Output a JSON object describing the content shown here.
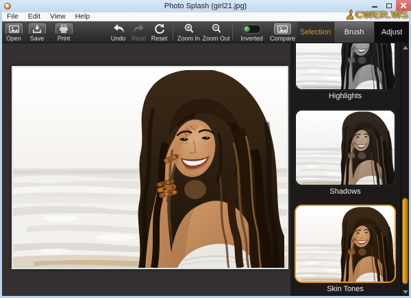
{
  "window": {
    "title": "Photo Splash (girl21.jpg)",
    "watermark": "CWER.WS"
  },
  "menu": {
    "items": [
      "File",
      "Edit",
      "View",
      "Help"
    ]
  },
  "toolbar": {
    "buttons": {
      "open": "Open",
      "save": "Save",
      "print": "Print",
      "undo": "Undo",
      "redo": "Redo",
      "reset": "Reset",
      "zoom_in": "Zoom In",
      "zoom_out": "Zoom Out",
      "inverted": "Inverted",
      "compare": "Compare"
    },
    "states": {
      "redo_enabled": false,
      "inverted_on": true
    }
  },
  "tabs": {
    "items": [
      {
        "label": "Selection",
        "active": true
      },
      {
        "label": "Brush",
        "active": false
      },
      {
        "label": "Adjust",
        "active": false
      }
    ]
  },
  "panel": {
    "thumbnails": [
      {
        "label": "Highlights",
        "selected": false,
        "filter": "grayscale"
      },
      {
        "label": "Shadows",
        "selected": false,
        "filter": "half-saturated"
      },
      {
        "label": "Skin Tones",
        "selected": true,
        "filter": "full-color"
      }
    ]
  },
  "image": {
    "alt": "Young woman with long dark wavy hair smiling on a white beach, hand raised to her head, wearing beaded bracelets"
  },
  "icons": {
    "app": "orange-ring-icon",
    "minimize": "dash",
    "maximize": "square-outline",
    "close": "x-cross",
    "open": "picture-frame",
    "save": "arrow-into-tray",
    "print": "printer",
    "undo": "curved-arrow-left",
    "redo": "curved-arrow-right",
    "reset": "refresh-circle",
    "zoom_in": "magnifier-plus",
    "zoom_out": "magnifier-minus",
    "inverted": "toggle-switch-green",
    "compare": "picture-frame",
    "scroll_up": "triangle-up",
    "scroll_down": "triangle-down"
  },
  "colors": {
    "accent_orange": "#e0921e",
    "selected_border": "#e8941c",
    "close_button": "#cf5d5d",
    "titlebar": "#c9ddf1",
    "toolbar_dark": "#3a3a3a",
    "panel_dark": "#1d1b1a",
    "scroll_thumb": "#cf8c1c"
  }
}
